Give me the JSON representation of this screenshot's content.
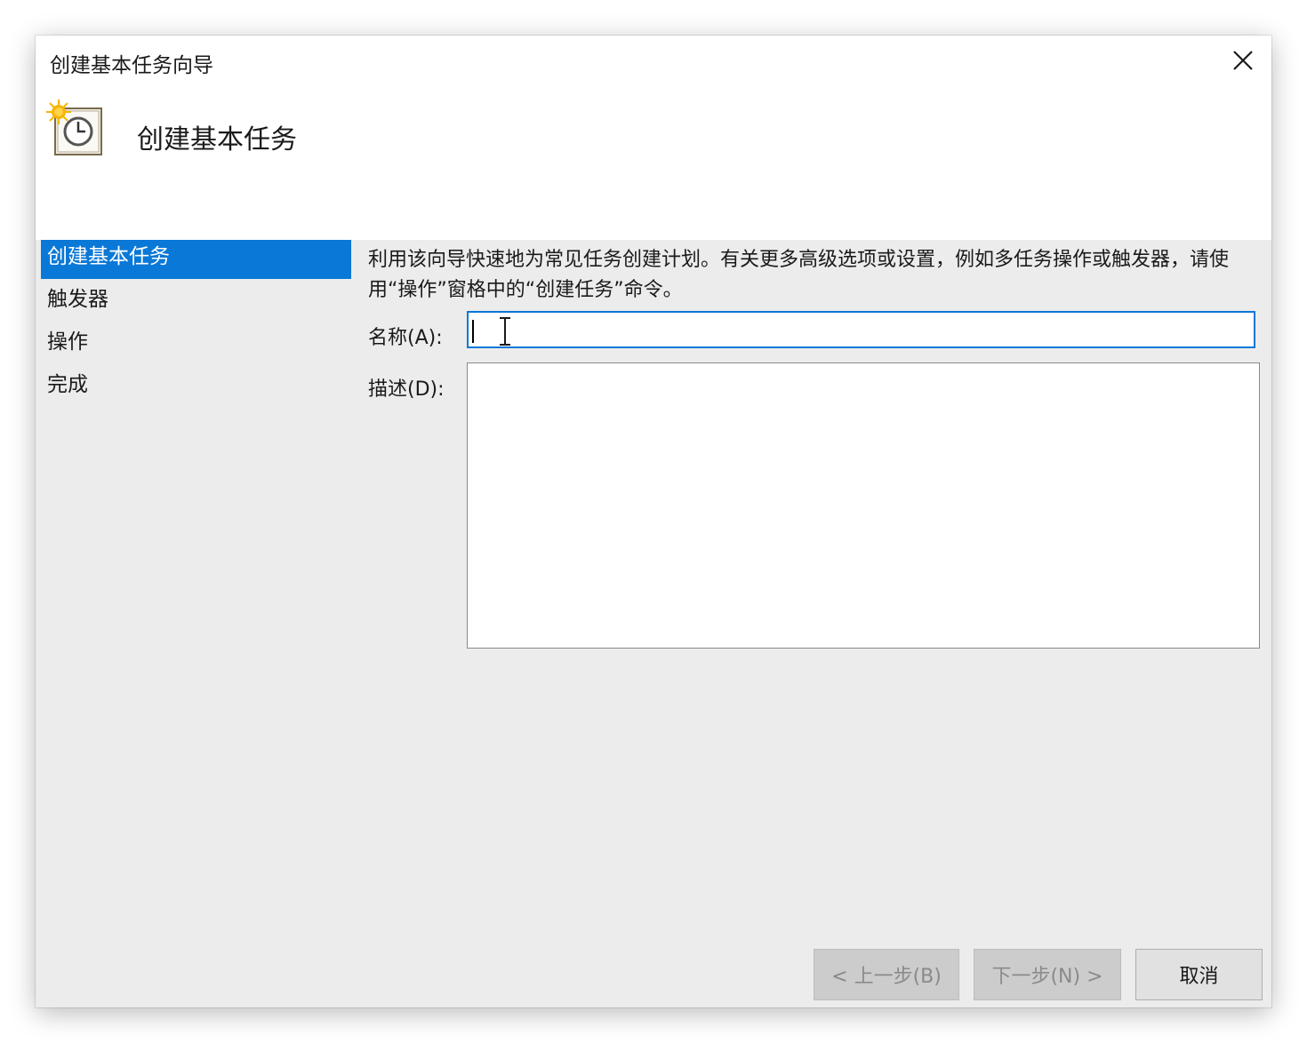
{
  "window": {
    "title": "创建基本任务向导",
    "header_title": "创建基本任务"
  },
  "icons": {
    "close": "close-icon",
    "header": "task-scheduler-clock-icon",
    "cursor": "text-ibeam-cursor-icon"
  },
  "steps": [
    {
      "label": "创建基本任务",
      "active": true
    },
    {
      "label": "触发器",
      "active": false
    },
    {
      "label": "操作",
      "active": false
    },
    {
      "label": "完成",
      "active": false
    }
  ],
  "content": {
    "intro": "利用该向导快速地为常见任务创建计划。有关更多高级选项或设置，例如多任务操作或触发器，请使用“操作”窗格中的“创建任务”命令。",
    "name_label": "名称(A):",
    "name_value": "",
    "description_label": "描述(D):",
    "description_value": ""
  },
  "buttons": {
    "back": "< 上一步(B)",
    "next": "下一步(N) >",
    "cancel": "取消"
  },
  "colors": {
    "accent": "#0a78d7",
    "dialog_bg": "#ececec",
    "header_bg": "#ffffff",
    "disabled_button_bg": "#cccccc"
  }
}
